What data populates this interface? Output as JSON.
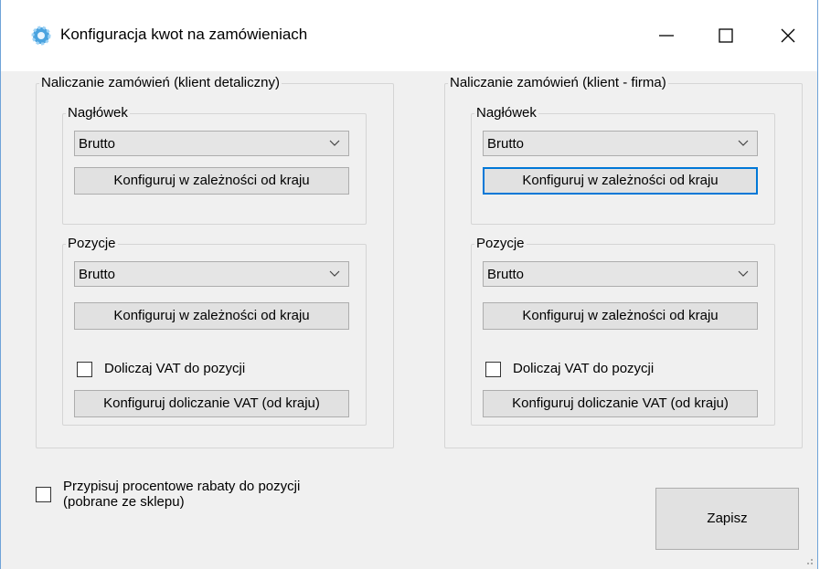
{
  "window": {
    "title": "Konfiguracja kwot na zamówieniach",
    "icon": "gear-icon",
    "controls": {
      "minimize": "minimize-icon",
      "maximize": "maximize-icon",
      "close": "close-icon"
    }
  },
  "retail": {
    "title": "Naliczanie zamówień (klient detaliczny)",
    "header": {
      "title": "Nagłówek",
      "select_value": "Brutto",
      "config_button": "Konfiguruj w zależności od kraju"
    },
    "items": {
      "title": "Pozycje",
      "select_value": "Brutto",
      "config_button": "Konfiguruj w zależności od kraju",
      "vat_checkbox": "Doliczaj VAT do pozycji",
      "vat_checked": false,
      "vat_button": "Konfiguruj doliczanie VAT (od kraju)"
    }
  },
  "company": {
    "title": "Naliczanie zamówień (klient - firma)",
    "header": {
      "title": "Nagłówek",
      "select_value": "Brutto",
      "config_button": "Konfiguruj w zależności od kraju"
    },
    "items": {
      "title": "Pozycje",
      "select_value": "Brutto",
      "config_button": "Konfiguruj w zależności od kraju",
      "vat_checkbox": "Doliczaj VAT do pozycji",
      "vat_checked": false,
      "vat_button": "Konfiguruj doliczanie VAT (od kraju)"
    }
  },
  "discount": {
    "label_line1": "Przypisuj procentowe rabaty do pozycji",
    "label_line2": "(pobrane ze sklepu)",
    "checked": false
  },
  "save_button": "Zapisz",
  "colors": {
    "focus": "#0078d7",
    "window_border": "#6fa3d8",
    "background": "#f0f0f0"
  }
}
